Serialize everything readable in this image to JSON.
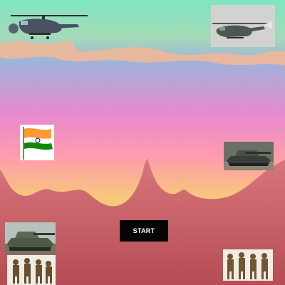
{
  "game": {
    "start_button_label": "START",
    "sky_colors": {
      "top": "#7fe6c2",
      "band": "#f3b795",
      "mid": "#9fb2d8",
      "pink": "#e68ad0",
      "low": "#ff9cac",
      "horizon": "#f6c978",
      "ground_top": "#d7777b",
      "ground_bottom": "#b64c55"
    },
    "sprites": [
      {
        "name": "helicopter-sprite",
        "icon": "attack-helicopter"
      },
      {
        "name": "helicopter-photo-sprite",
        "icon": "attack-helicopter-photo"
      },
      {
        "name": "india-flag-sprite",
        "icon": "india-flag",
        "colors": [
          "#ff9933",
          "#ffffff",
          "#138808",
          "#000080"
        ]
      },
      {
        "name": "tank-sprite-right",
        "icon": "battle-tank"
      },
      {
        "name": "tank-sprite-left",
        "icon": "battle-tank"
      },
      {
        "name": "soldiers-sprite-left",
        "icon": "soldier-squad"
      },
      {
        "name": "soldiers-sprite-right",
        "icon": "soldier-squad"
      }
    ]
  }
}
